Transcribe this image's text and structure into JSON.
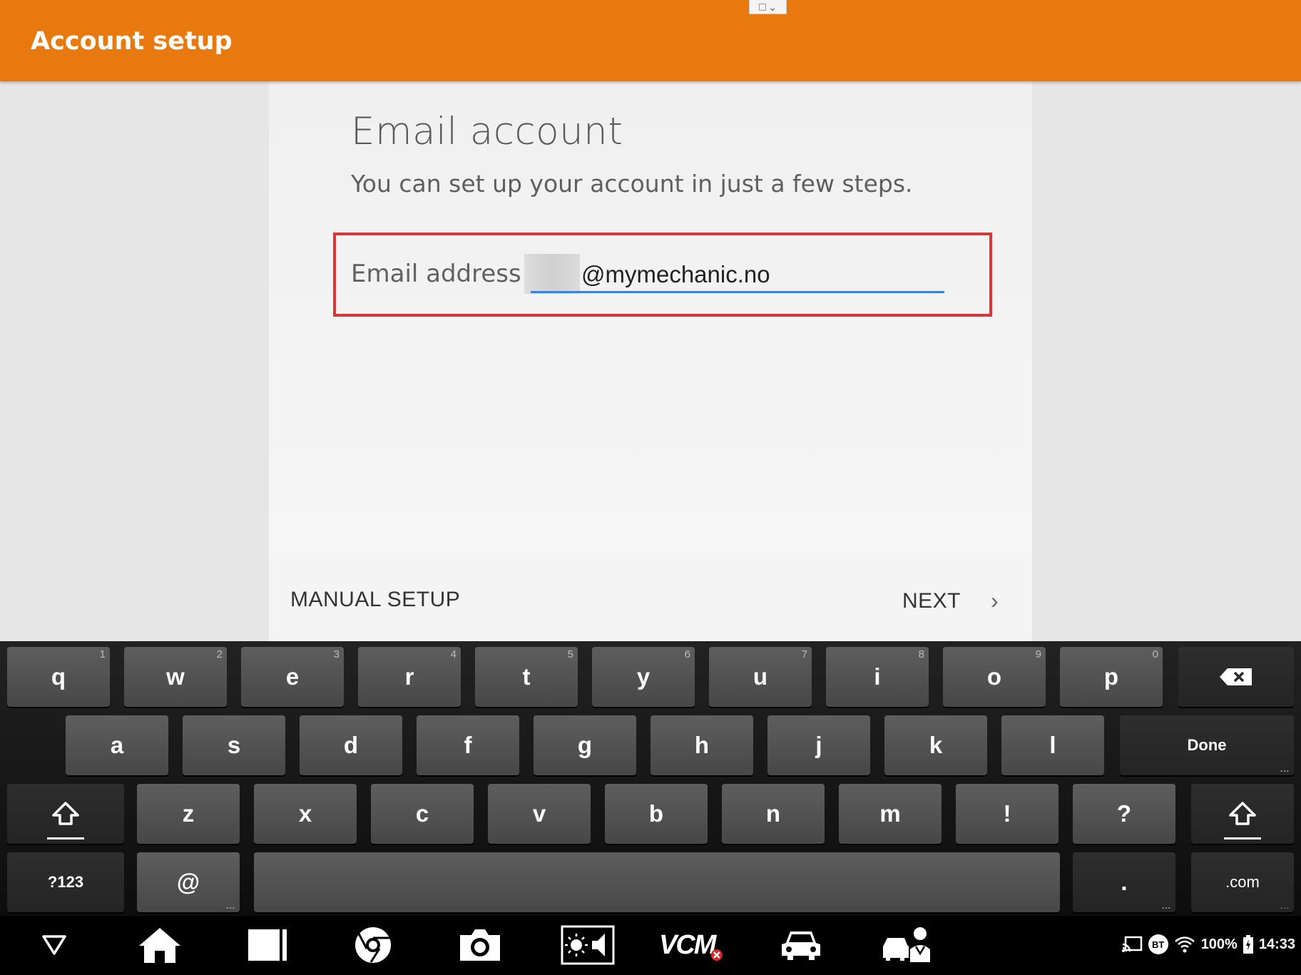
{
  "header": {
    "title": "Account setup"
  },
  "form": {
    "heading": "Email account",
    "subheading": "You can set up your account in just a few steps.",
    "email_label": "Email address",
    "email_value": "@mymechanic.no"
  },
  "actions": {
    "manual_setup": "MANUAL SETUP",
    "next": "NEXT",
    "next_chevron": "›"
  },
  "keyboard": {
    "row1": [
      {
        "label": "q",
        "hint": "1"
      },
      {
        "label": "w",
        "hint": "2"
      },
      {
        "label": "e",
        "hint": "3"
      },
      {
        "label": "r",
        "hint": "4"
      },
      {
        "label": "t",
        "hint": "5"
      },
      {
        "label": "y",
        "hint": "6"
      },
      {
        "label": "u",
        "hint": "7"
      },
      {
        "label": "i",
        "hint": "8"
      },
      {
        "label": "o",
        "hint": "9"
      },
      {
        "label": "p",
        "hint": "0"
      }
    ],
    "row2": [
      "a",
      "s",
      "d",
      "f",
      "g",
      "h",
      "j",
      "k",
      "l"
    ],
    "row3": [
      "z",
      "x",
      "c",
      "v",
      "b",
      "n",
      "m",
      "!",
      "?"
    ],
    "done": "Done",
    "symbols": "?123",
    "at": "@",
    "period": ".",
    "dotcom": ".com",
    "dots": "..."
  },
  "navbar": {
    "vcm_label": "VCM",
    "battery": "100%",
    "time": "14:33",
    "bt_label": "BT"
  },
  "colors": {
    "accent": "#e8790f",
    "highlight": "#d9363a",
    "underline": "#3f7fe0"
  }
}
